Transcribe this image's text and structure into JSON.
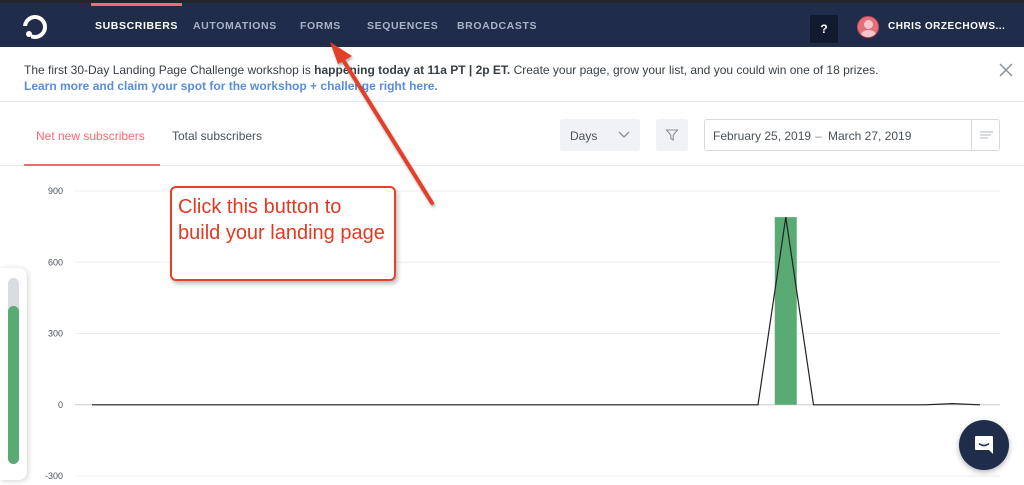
{
  "nav": {
    "items": [
      {
        "label": "SUBSCRIBERS",
        "active": true
      },
      {
        "label": "AUTOMATIONS",
        "active": false
      },
      {
        "label": "FORMS",
        "active": false
      },
      {
        "label": "SEQUENCES",
        "active": false
      },
      {
        "label": "BROADCASTS",
        "active": false
      }
    ],
    "help_label": "?",
    "user_name": "CHRIS ORZECHOWS..."
  },
  "announcement": {
    "text_before": "The first 30-Day Landing Page Challenge workshop is ",
    "text_bold": "happening today at 11a PT | 2p ET.",
    "text_after": " Create your page, grow your list, and you could win one of 18 prizes.",
    "link": "Learn more and claim your spot for the workshop + challenge right here."
  },
  "tabs": [
    {
      "label": "Net new subscribers",
      "active": true
    },
    {
      "label": "Total subscribers",
      "active": false
    }
  ],
  "controls": {
    "interval": "Days",
    "date_start": "February 25, 2019",
    "date_separator": "–",
    "date_end": "March 27, 2019"
  },
  "annotation": {
    "text": "Click this button to build your landing page"
  },
  "progress_widget": {
    "fill_fraction": 0.85
  },
  "colors": {
    "nav_bg": "#1f2d4b",
    "accent": "#fb6970",
    "bar": "#5aab73",
    "link": "#5b8dd8",
    "annotation": "#e2412b"
  },
  "chart_data": {
    "type": "bar",
    "y_ticks": [
      900,
      600,
      300,
      0,
      -300
    ],
    "ylim": [
      -300,
      900
    ],
    "bars": [
      {
        "index": 25,
        "value": 790
      }
    ],
    "line_values": [
      0,
      0,
      0,
      0,
      0,
      0,
      0,
      0,
      0,
      0,
      0,
      0,
      0,
      0,
      0,
      0,
      0,
      0,
      0,
      0,
      0,
      0,
      0,
      0,
      0,
      790,
      0,
      0,
      0,
      0,
      0,
      5,
      0
    ],
    "grid": true,
    "legend": "none"
  }
}
